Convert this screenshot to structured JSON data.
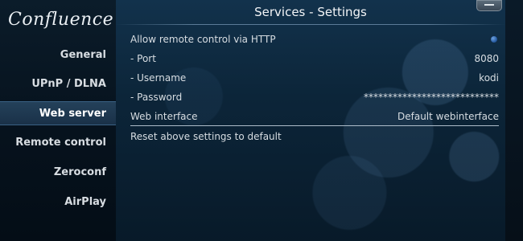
{
  "app": {
    "logo": "Confluence"
  },
  "sidebar": {
    "items": [
      {
        "label": "General",
        "active": false
      },
      {
        "label": "UPnP / DLNA",
        "active": false
      },
      {
        "label": "Web server",
        "active": true
      },
      {
        "label": "Remote control",
        "active": false
      },
      {
        "label": "Zeroconf",
        "active": false
      },
      {
        "label": "AirPlay",
        "active": false
      }
    ]
  },
  "header": {
    "title": "Services - Settings"
  },
  "settings": {
    "allow_remote": {
      "label": "Allow remote control via HTTP",
      "enabled": true
    },
    "port": {
      "label": "- Port",
      "value": "8080"
    },
    "username": {
      "label": "- Username",
      "value": "kodi"
    },
    "password": {
      "label": "- Password",
      "value": "****************************"
    },
    "web_interface": {
      "label": "Web interface",
      "value": "Default webinterface"
    },
    "reset": {
      "label": "Reset above settings to default"
    }
  },
  "colors": {
    "accent": "#2a5fa6",
    "active_nav": "#24415a"
  }
}
